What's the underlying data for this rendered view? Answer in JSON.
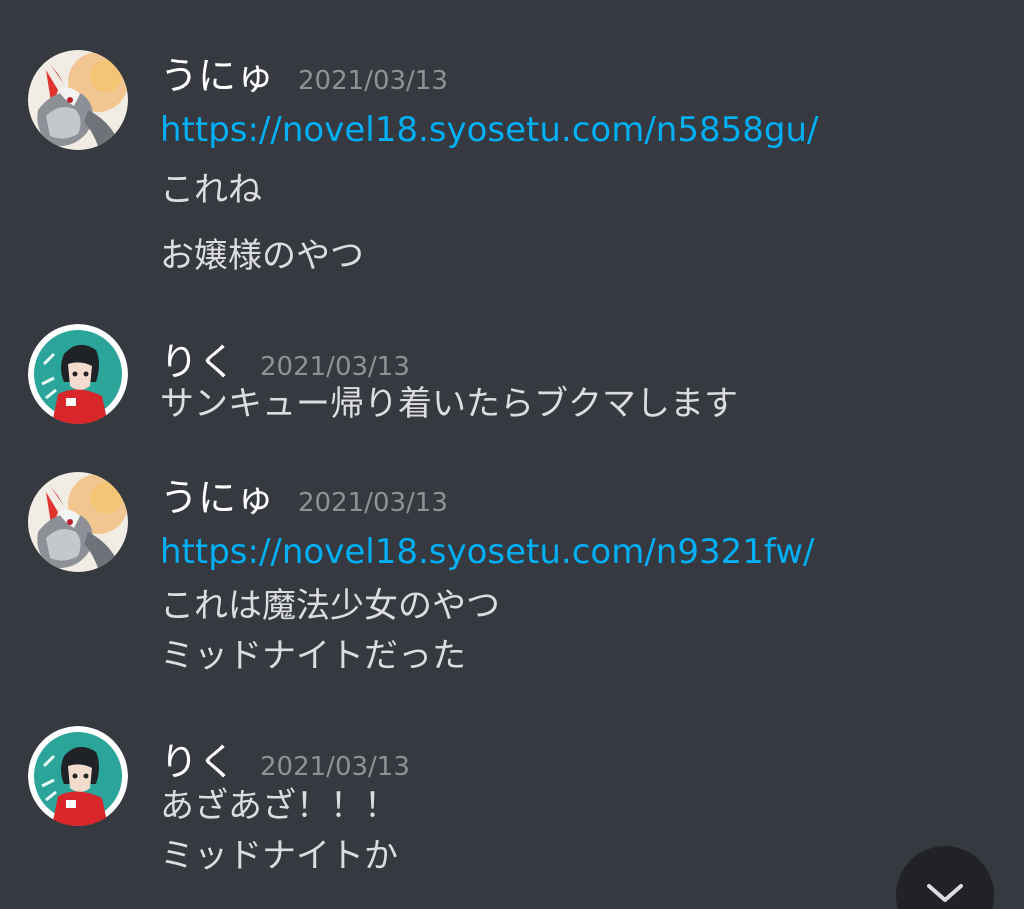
{
  "messages": [
    {
      "author": "うにゅ",
      "timestamp": "2021/03/13",
      "avatar_icon": "red-fox-avatar-icon",
      "lines": [
        {
          "text": "https://novel18.syosetu.com/n5858gu/",
          "is_link": true
        },
        {
          "text": "これね",
          "is_link": false
        },
        {
          "text": "お嬢様のやつ",
          "is_link": false
        }
      ]
    },
    {
      "author": "りく",
      "timestamp": "2021/03/13",
      "avatar_icon": "anime-boy-avatar-icon",
      "lines": [
        {
          "text": "サンキュー帰り着いたらブクマします",
          "is_link": false
        }
      ]
    },
    {
      "author": "うにゅ",
      "timestamp": "2021/03/13",
      "avatar_icon": "red-fox-avatar-icon",
      "lines": [
        {
          "text": "https://novel18.syosetu.com/n9321fw/",
          "is_link": true
        },
        {
          "text": "これは魔法少女のやつ",
          "is_link": false
        },
        {
          "text": "ミッドナイトだった",
          "is_link": false
        }
      ]
    },
    {
      "author": "りく",
      "timestamp": "2021/03/13",
      "avatar_icon": "anime-boy-avatar-icon",
      "lines": [
        {
          "text": "あざあざ！！！",
          "is_link": false
        },
        {
          "text": "ミッドナイトか",
          "is_link": false
        }
      ]
    }
  ],
  "scroll_button_icon": "chevron-down-icon",
  "colors": {
    "background": "#36393f",
    "username": "#ffffff",
    "timestamp": "#8e9297",
    "text": "#dcddde",
    "link": "#00aff4",
    "scroll_button": "#202225"
  }
}
